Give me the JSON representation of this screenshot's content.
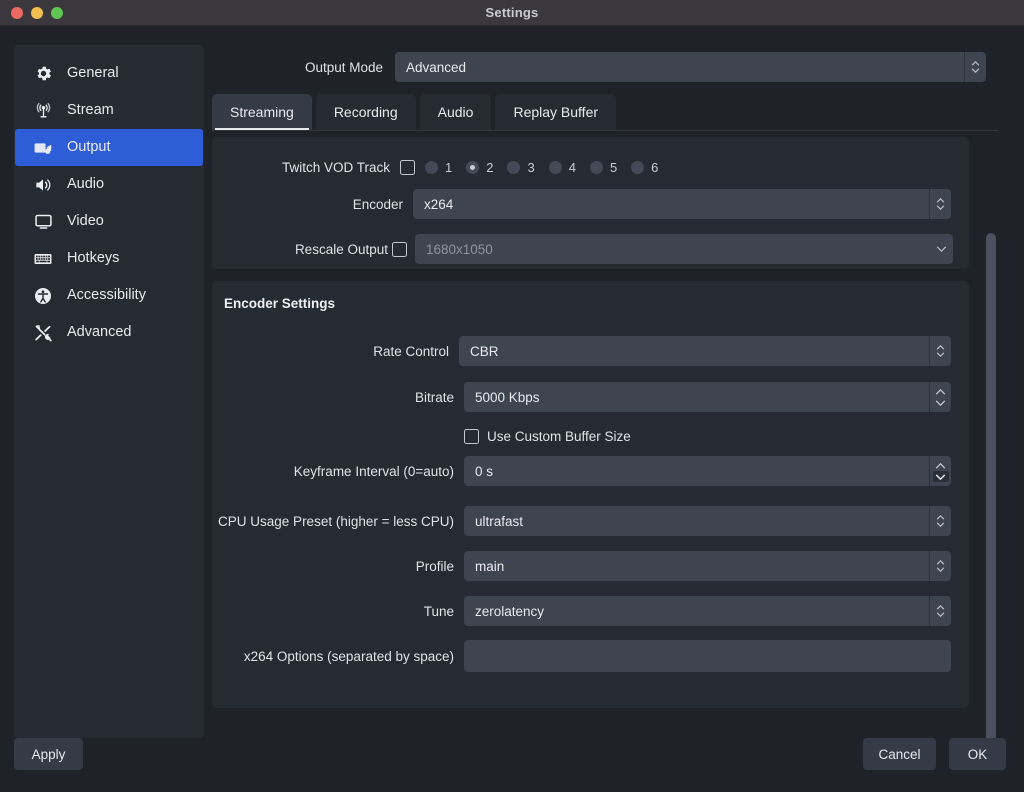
{
  "window": {
    "title": "Settings",
    "traffic_lights": [
      "close",
      "minimize",
      "maximize"
    ]
  },
  "sidebar": {
    "items": [
      {
        "label": "General",
        "icon": "gear-icon",
        "active": false
      },
      {
        "label": "Stream",
        "icon": "broadcast-icon",
        "active": false
      },
      {
        "label": "Output",
        "icon": "video-camera-icon",
        "active": true
      },
      {
        "label": "Audio",
        "icon": "speaker-icon",
        "active": false
      },
      {
        "label": "Video",
        "icon": "monitor-icon",
        "active": false
      },
      {
        "label": "Hotkeys",
        "icon": "keyboard-icon",
        "active": false
      },
      {
        "label": "Accessibility",
        "icon": "accessibility-icon",
        "active": false
      },
      {
        "label": "Advanced",
        "icon": "tools-icon",
        "active": false
      }
    ]
  },
  "output_mode": {
    "label": "Output Mode",
    "value": "Advanced"
  },
  "tabs": [
    {
      "label": "Streaming",
      "active": true
    },
    {
      "label": "Recording",
      "active": false
    },
    {
      "label": "Audio",
      "active": false
    },
    {
      "label": "Replay Buffer",
      "active": false
    }
  ],
  "streaming": {
    "twitch_vod_track": {
      "label": "Twitch VOD Track",
      "checked": false,
      "tracks": [
        "1",
        "2",
        "3",
        "4",
        "5",
        "6"
      ],
      "selected_track": "2"
    },
    "encoder": {
      "label": "Encoder",
      "value": "x264"
    },
    "rescale_output": {
      "label": "Rescale Output",
      "checked": false,
      "value": "1680x1050",
      "enabled": false
    }
  },
  "encoder_settings": {
    "title": "Encoder Settings",
    "rate_control": {
      "label": "Rate Control",
      "value": "CBR"
    },
    "bitrate": {
      "label": "Bitrate",
      "value": "5000 Kbps"
    },
    "use_custom_buffer_size": {
      "label": "Use Custom Buffer Size",
      "checked": false
    },
    "keyframe_interval": {
      "label": "Keyframe Interval (0=auto)",
      "value": "0 s"
    },
    "cpu_usage_preset": {
      "label": "CPU Usage Preset (higher = less CPU)",
      "value": "ultrafast"
    },
    "profile": {
      "label": "Profile",
      "value": "main"
    },
    "tune": {
      "label": "Tune",
      "value": "zerolatency"
    },
    "x264_options": {
      "label": "x264 Options (separated by space)",
      "value": ""
    }
  },
  "buttons": {
    "apply": "Apply",
    "cancel": "Cancel",
    "ok": "OK"
  },
  "colors": {
    "window_bg": "#1f2229",
    "panel_bg": "#262a33",
    "field_bg": "#3e4450",
    "accent": "#2d5dd7",
    "titlebar_bg": "#3a373d",
    "text": "#e8eaee",
    "muted_text": "#8d93a0",
    "scrollbar_thumb": "#4a505e"
  }
}
